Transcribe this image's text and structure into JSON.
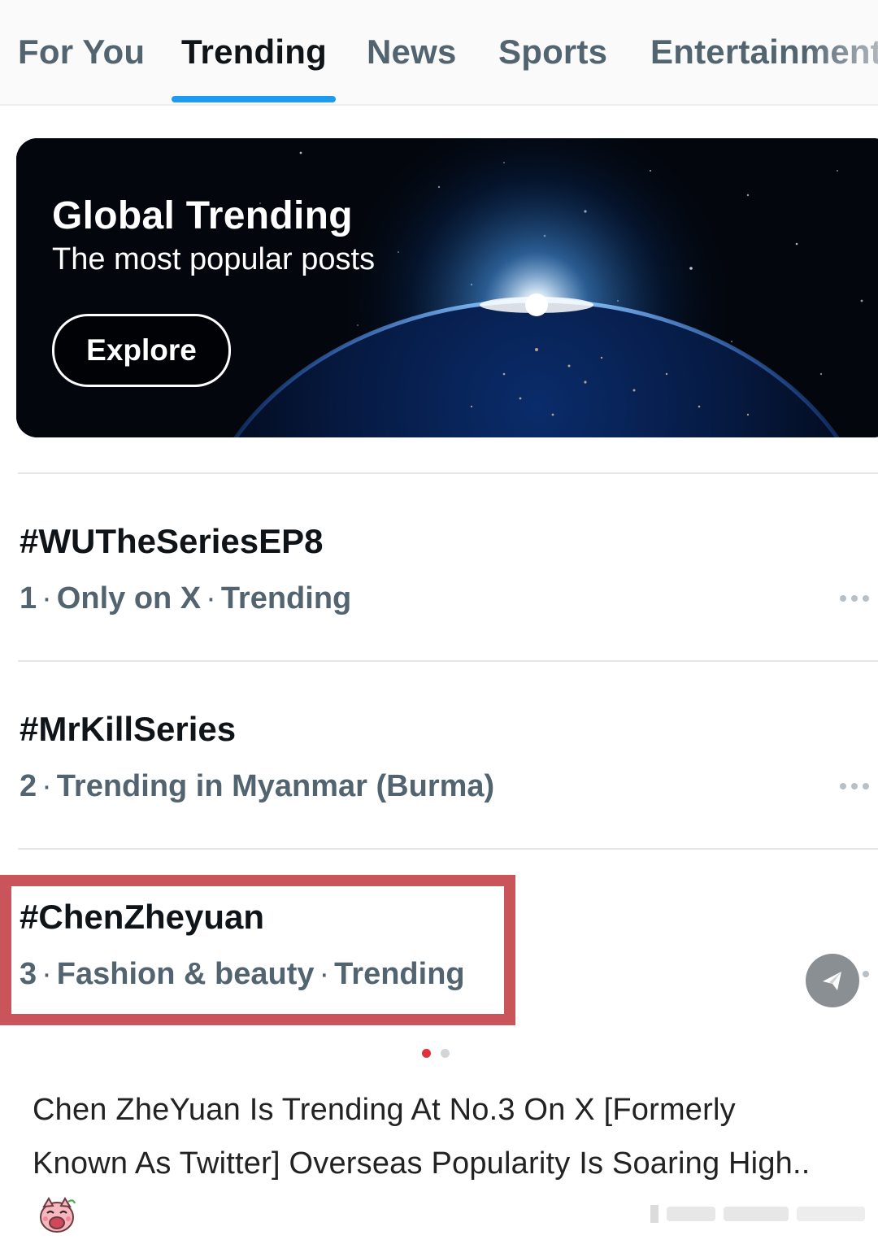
{
  "tabs": [
    {
      "label": "For You",
      "active": false
    },
    {
      "label": "Trending",
      "active": true
    },
    {
      "label": "News",
      "active": false
    },
    {
      "label": "Sports",
      "active": false
    },
    {
      "label": "Entertainment",
      "active": false
    }
  ],
  "banner": {
    "title": "Global Trending",
    "subtitle": "The most popular posts",
    "button_label": "Explore"
  },
  "trends": [
    {
      "rank": "1",
      "hashtag": "#WUTheSeriesEP8",
      "context": "Only on X",
      "status": "Trending"
    },
    {
      "rank": "2",
      "hashtag": "#MrKillSeries",
      "context": "Trending in Myanmar (Burma)",
      "status": ""
    },
    {
      "rank": "3",
      "hashtag": "#ChenZheyuan",
      "context": "Fashion & beauty",
      "status": "Trending"
    }
  ],
  "separator": "·",
  "pager": {
    "current": 1,
    "total": 2
  },
  "caption": {
    "text": "Chen ZheYuan Is Trending At No.3 On X [Formerly Known As Twitter] Overseas Popularity Is Soaring High.."
  },
  "colors": {
    "accent": "#1d9bf0",
    "highlight": "#c9555b",
    "secondary_text": "#536471",
    "pager_active": "#e0303a",
    "pager_inactive": "#d3d6d9"
  },
  "icons": {
    "more": "more-horizontal-icon",
    "share": "share-icon",
    "emoji": "laughing-pig-emoji"
  }
}
